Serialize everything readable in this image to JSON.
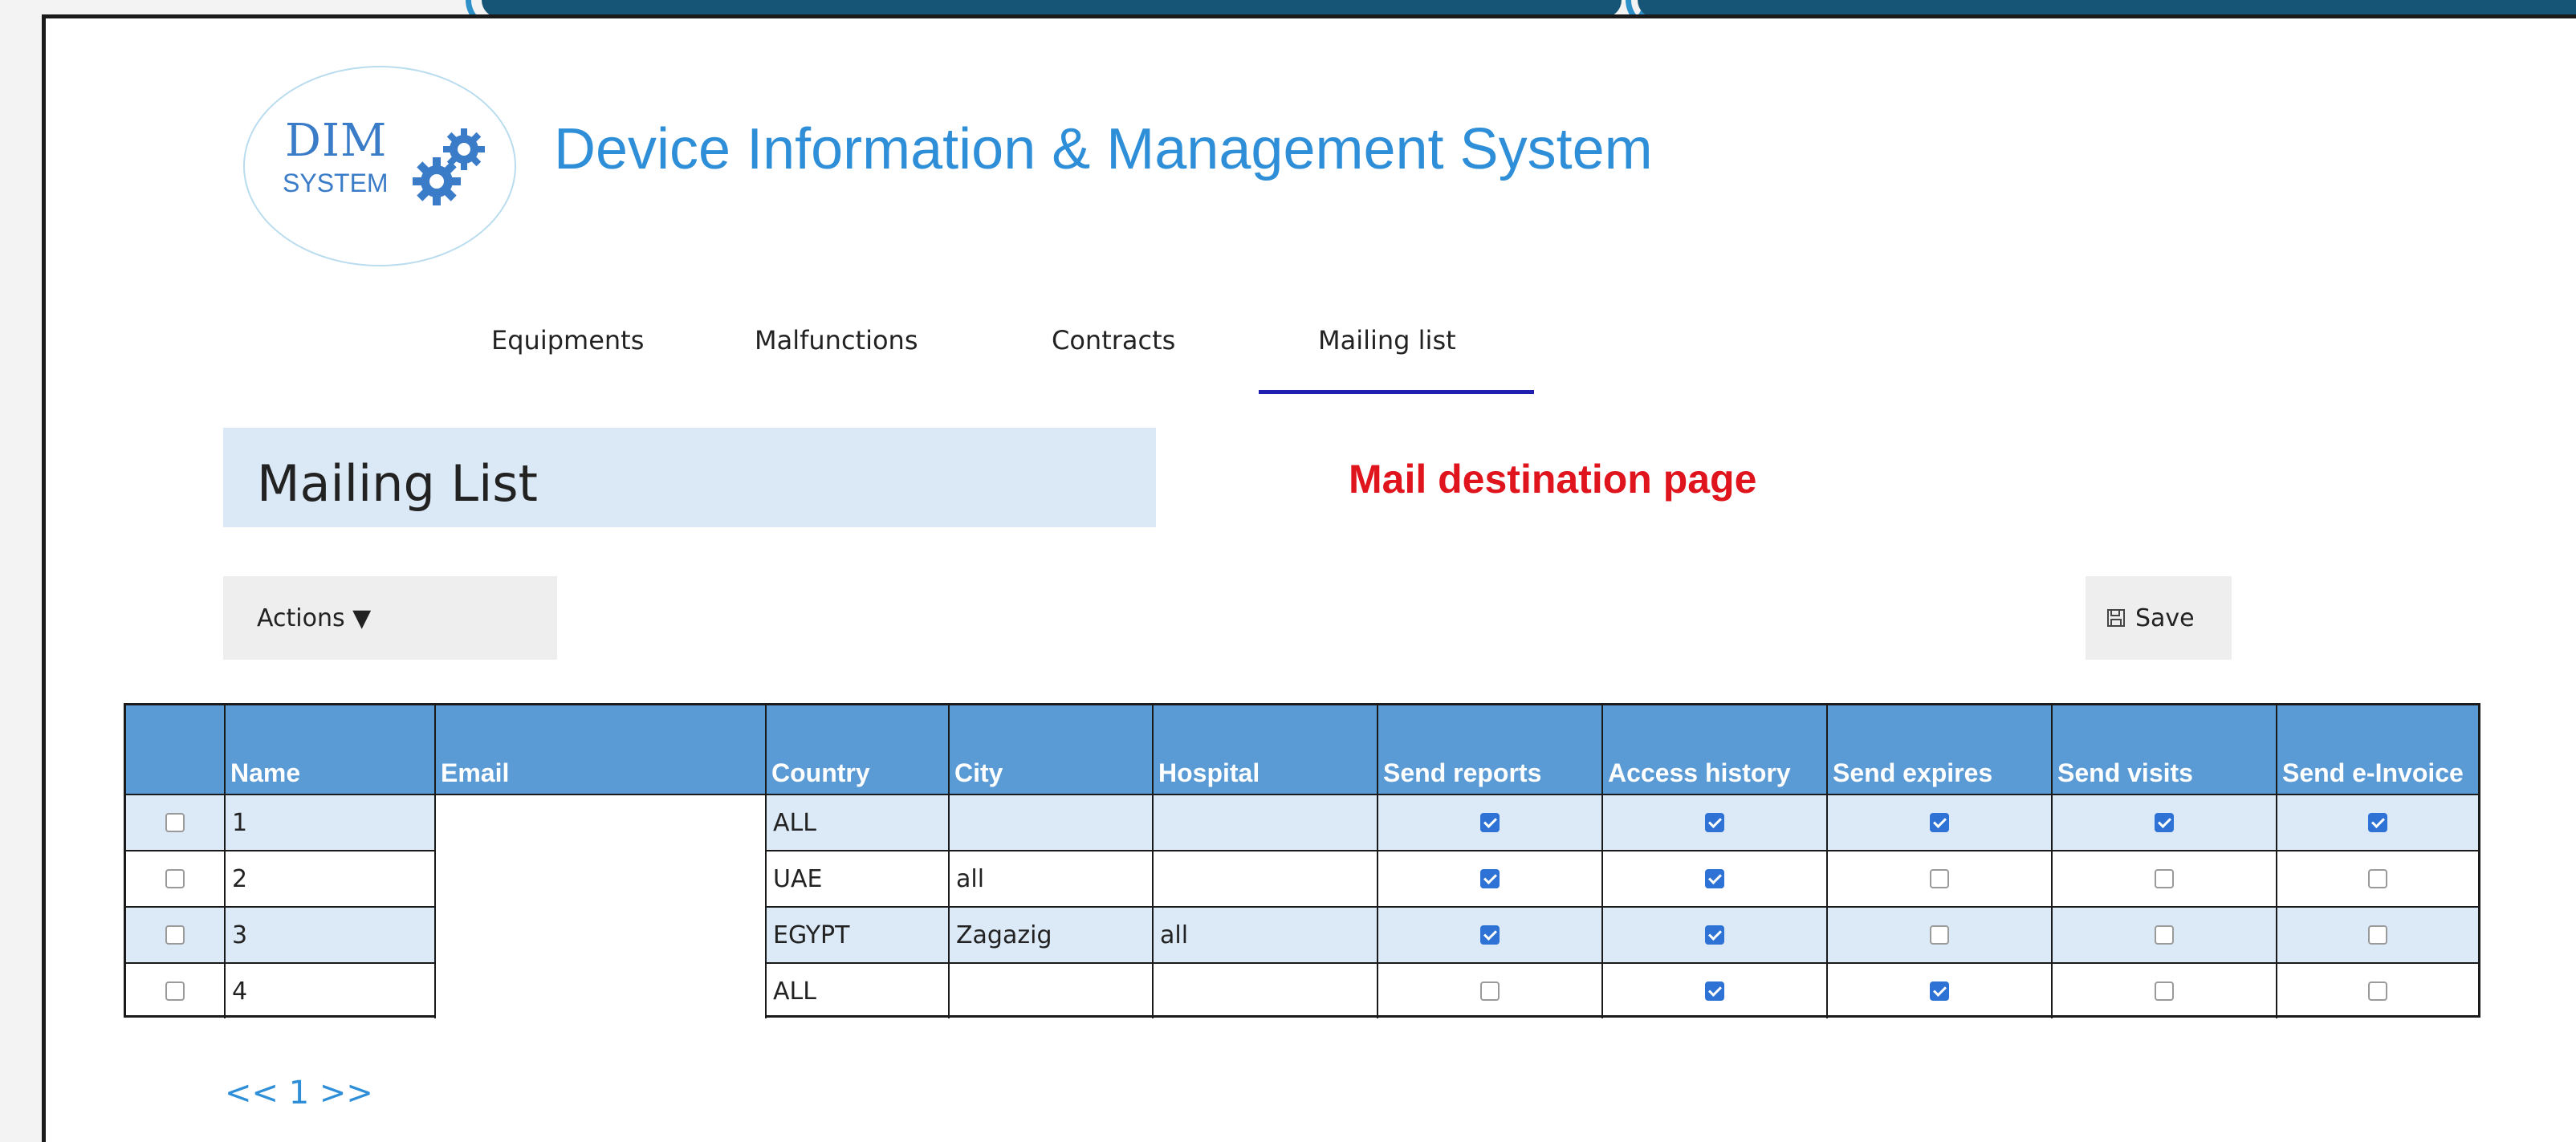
{
  "app": {
    "logo_text": "DIM",
    "logo_subtext": "SYSTEM",
    "title": "Device Information & Management System"
  },
  "nav": {
    "items": [
      {
        "label": "Equipments"
      },
      {
        "label": "Malfunctions"
      },
      {
        "label": "Contracts"
      },
      {
        "label": "Mailing list",
        "active": true
      }
    ]
  },
  "page": {
    "title": "Mailing List",
    "annotation": "Mail destination page",
    "annotation_color": "#e0141c"
  },
  "toolbar": {
    "actions_label": "Actions ▼",
    "save_icon": "floppy-disk-icon",
    "save_label": "Save"
  },
  "table": {
    "columns": [
      "",
      "Name",
      "Email",
      "Country",
      "City",
      "Hospital",
      "Send reports",
      "Access history",
      "Send expires",
      "Send visits",
      "Send e-Invoice"
    ],
    "rows": [
      {
        "name": "1",
        "email": "",
        "country": "ALL",
        "city": "",
        "hospital": "",
        "send_reports": true,
        "access_history": true,
        "send_expires": true,
        "send_visits": true,
        "send_einvoice": true
      },
      {
        "name": "2",
        "email": "",
        "country": "UAE",
        "city": "all",
        "hospital": "",
        "send_reports": true,
        "access_history": true,
        "send_expires": false,
        "send_visits": false,
        "send_einvoice": false
      },
      {
        "name": "3",
        "email": "",
        "country": "EGYPT",
        "city": "Zagazig",
        "hospital": "all",
        "send_reports": true,
        "access_history": true,
        "send_expires": false,
        "send_visits": false,
        "send_einvoice": false
      },
      {
        "name": "4",
        "email": "",
        "country": "ALL",
        "city": "",
        "hospital": "",
        "send_reports": false,
        "access_history": true,
        "send_expires": true,
        "send_visits": false,
        "send_einvoice": false
      }
    ]
  },
  "pagination": {
    "label": "<< 1 >>"
  },
  "colors": {
    "header_bg": "#5b9bd5",
    "alt_row_bg": "#dce9f6",
    "title_blue": "#2e8fd8",
    "active_tab_underline": "#1f1fb0"
  }
}
